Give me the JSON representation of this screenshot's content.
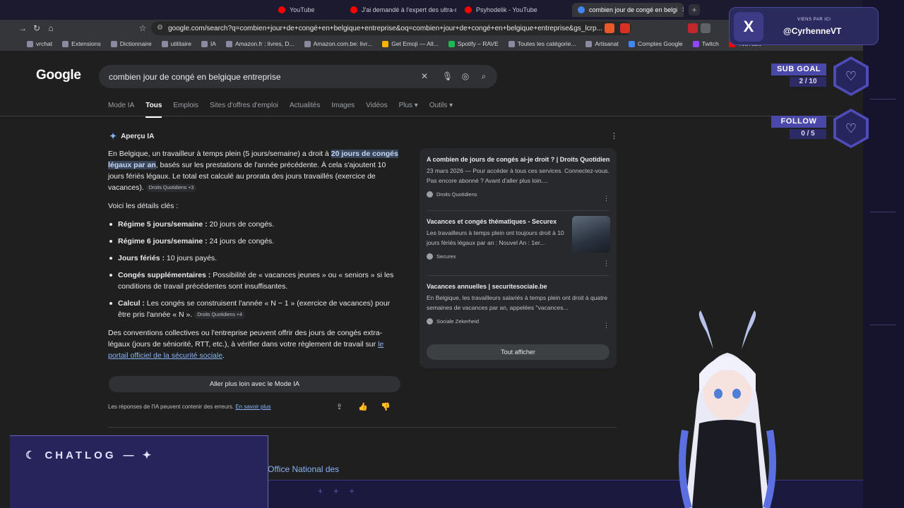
{
  "browser": {
    "tabs": [
      {
        "label": "YouTube",
        "color": "#ff0000"
      },
      {
        "label": "J'ai demandé à l'expert des ultra-rich",
        "color": "#ff0000"
      },
      {
        "label": "Psyhodelik - YouTube",
        "color": "#ff0000"
      },
      {
        "label": "combien jour de congé en belgi",
        "color": "#4285f4"
      }
    ],
    "url": "google.com/search?q=combien+jour+de+congé+en+belgique+entreprise&oq=combien+jour+de+congé+en+belgique+entreprise&gs_lcrp...",
    "bookmarks": [
      "vrchat",
      "Extensions",
      "Dictionnaire",
      "utilitaire",
      "IA",
      "Amazon.fr : livres, D...",
      "Amazon.com.be: livr...",
      "Get Emoji — All...",
      "Spotify – RAVE",
      "Toutes les catégorie...",
      "Artisanat",
      "Comptes Google",
      "Twitch",
      "YouTube"
    ]
  },
  "google": {
    "logo": "Google",
    "query": "combien jour de congé en belgique entreprise",
    "nav_tabs": [
      "Mode IA",
      "Tous",
      "Emplois",
      "Sites d'offres d'emploi",
      "Actualités",
      "Images",
      "Vidéos",
      "Plus ▾",
      "Outils ▾"
    ],
    "active_tab": "Tous"
  },
  "ai_overview": {
    "heading": "Aperçu IA",
    "intro_pre": "En Belgique, un travailleur à temps plein (5 jours/semaine) a droit à ",
    "intro_highlight": "20 jours de congés légaux par an",
    "intro_post": ", basés sur les prestations de l'année précédente. À cela s'ajoutent 10 jours fériés légaux. Le total est calculé au prorata des jours travaillés (exercice de vacances).",
    "intro_chip": "Droits Quotidiens +3",
    "details_label": "Voici les détails clés :",
    "bullets": [
      {
        "term": "Régime 5 jours/semaine :",
        "text": " 20 jours de congés."
      },
      {
        "term": "Régime 6 jours/semaine :",
        "text": " 24 jours de congés."
      },
      {
        "term": "Jours fériés :",
        "text": " 10 jours payés."
      },
      {
        "term": "Congés supplémentaires :",
        "text": " Possibilité de « vacances jeunes » ou « seniors » si les conditions de travail précédentes sont insuffisantes."
      },
      {
        "term": "Calcul :",
        "text": " Les congés se construisent l'année « N − 1 » (exercice de vacances) pour être pris l'année « N ».",
        "chip": "Droits Quotidiens +4"
      }
    ],
    "outro_pre": "Des conventions collectives ou l'entreprise peuvent offrir des jours de congés extra-légaux (jours de séniorité, RTT, etc.), à vérifier dans votre règlement de travail sur ",
    "outro_link": "le portail officiel de la sécurité sociale",
    "outro_post": ".",
    "deeper_button": "Aller plus loin avec le Mode IA",
    "disclaimer": "Les réponses de l'IA peuvent contenir des erreurs.",
    "learn_more": "En savoir plus"
  },
  "sources": [
    {
      "title": "A combien de jours de congés ai-je droit ? | Droits Quotidiens",
      "desc": "23 mars 2026 — Pour accéder à tous ces services. Connectez-vous. Pas encore abonné ? Avant d'aller plus loin....",
      "site": "Droits Quotidiens"
    },
    {
      "title": "Vacances et congés thématiques - Securex",
      "desc": "Les travailleurs à temps plein ont toujours droit à 10 jours fériés légaux par an : Nouvel An : 1er...",
      "site": "Securex"
    },
    {
      "title": "Vacances annuelles | securitesociale.be",
      "desc": "En Belgique, les travailleurs salariés à temps plein ont droit à quatre semaines de vacances par an, appelées \"vacances...",
      "site": "Sociale Zekerheid"
    }
  ],
  "show_all": "Tout afficher",
  "below_result": "Office National des",
  "stream": {
    "x_small": "VIENS PAR ICI",
    "x_handle": "@CyrhenneVT",
    "sub_goal_label": "SUB GOAL",
    "sub_goal_count": "2 / 10",
    "follow_label": "FOLLOW",
    "follow_count": "0 / 5",
    "chatlog_title": "CHATLOG"
  }
}
